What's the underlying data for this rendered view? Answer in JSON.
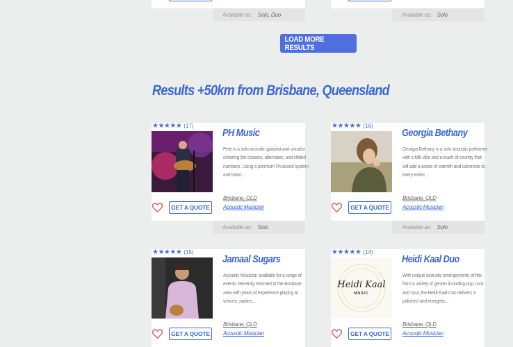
{
  "top": {
    "left_footer": {
      "label": "Available as:",
      "value": "Solo, Duo"
    },
    "right_footer": {
      "label": "Available as:",
      "value": "Solo"
    }
  },
  "load_more": "LOAD MORE RESULTS",
  "section_title": "Results +50km from Brisbane, Queensland",
  "cards": [
    {
      "stars": "★★★★★",
      "count": "(17)",
      "name": "PH Music",
      "desc": "Pete is a solo acoustic guitarist and vocalist covering the classics, alternates, and chilled numbers. Using a premium PA sound system and basic...",
      "location": "Brisbane, QLD",
      "category": "Acoustic Musician",
      "quote": "GET A QUOTE",
      "avail_label": "Available as:",
      "avail": "Solo"
    },
    {
      "stars": "★★★★★",
      "count": "(16)",
      "name": "Georgia Bethany",
      "desc": "Georgia Bethany is a solo acoustic performer with a folk vibe and a touch of country that will add a sense of warmth and calmness to every event ...",
      "location": "Brisbane, QLD",
      "category": "Acoustic Musician",
      "quote": "GET A QUOTE",
      "avail_label": "Available as:",
      "avail": "Solo"
    },
    {
      "stars": "★★★★★",
      "count": "(15)",
      "name": "Jamaal Sugars",
      "desc": "Acoustic Musician available for a range of events. Recently returned to the Brisbane area with years of experience playing at venues, parties,...",
      "location": "Brisbane, QLD",
      "category": "Acoustic Musician",
      "quote": "GET A QUOTE"
    },
    {
      "stars": "★★★★★",
      "count": "(14)",
      "name": "Heidi Kaal Duo",
      "desc": "With unique acoustic arrangements of hits from a variety of genres including pop, rock and soul, the Heidi Kaal Duo delivers a polished and energetic...",
      "location": "Brisbane, QLD",
      "category": "Acoustic Musician",
      "quote": "GET A QUOTE",
      "logo_line1": "Heidi Kaal",
      "logo_line2": "MUSIC"
    }
  ],
  "colors": {
    "accent": "#3b67d6",
    "heart": "#d9566c",
    "background": "#eceeed"
  }
}
